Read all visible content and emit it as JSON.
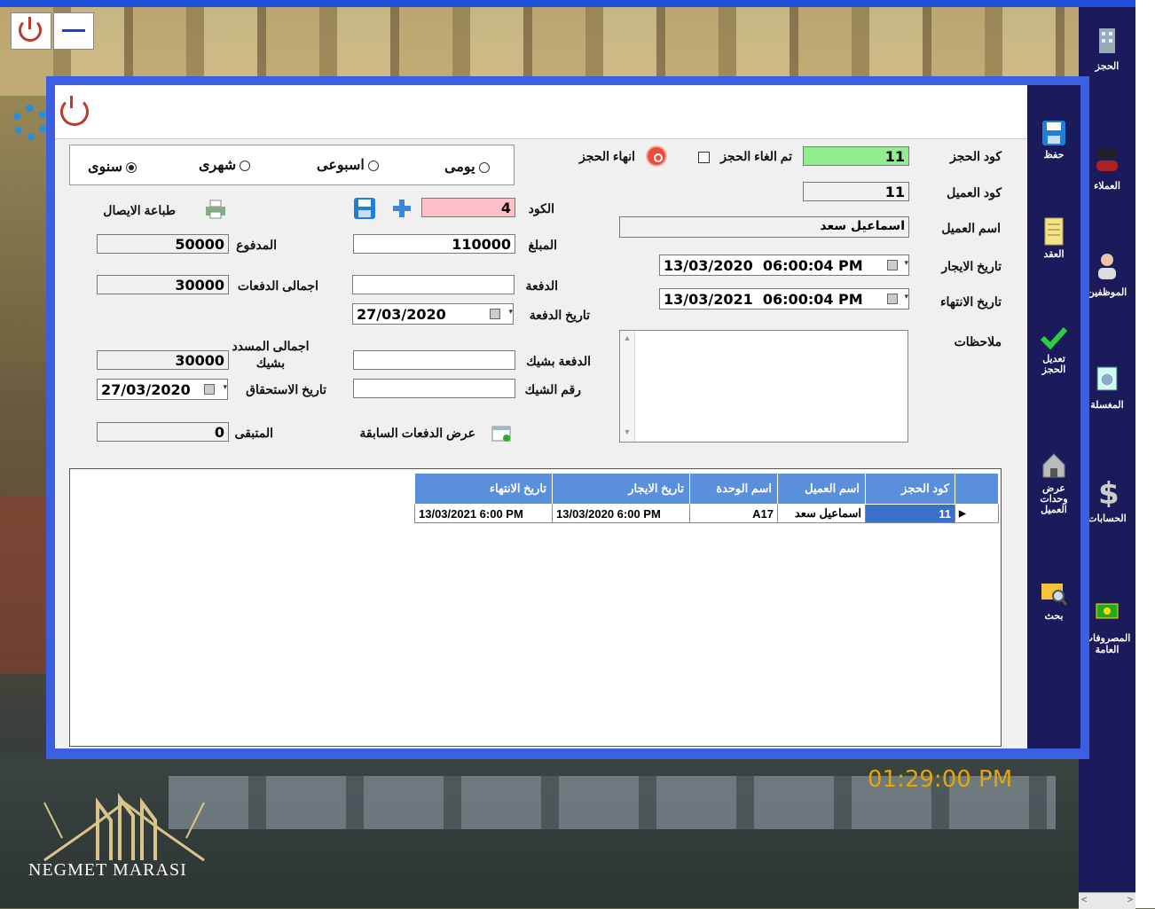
{
  "window": {
    "close_label": "power",
    "minimize_label": "minimize"
  },
  "sidebar": {
    "items": [
      {
        "label": "الحجز",
        "icon": "building-icon"
      },
      {
        "label": "العملاء",
        "icon": "users-icon"
      },
      {
        "label": "الموظفين",
        "icon": "employee-icon"
      },
      {
        "label": "المغسلة",
        "icon": "washing-machine-icon"
      },
      {
        "label": "الحسابات",
        "icon": "dollar-icon"
      },
      {
        "label": "المصروفات العامة",
        "icon": "money-icon"
      }
    ]
  },
  "nav": {
    "save": "حفظ",
    "contract": "العقد",
    "edit_booking": "تعديل الحجز",
    "client_units": "عرض وحدات العميل",
    "search": "بحث"
  },
  "form": {
    "booking_code_label": "كود الحجز",
    "booking_code": "11",
    "client_code_label": "كود العميل",
    "client_code": "11",
    "client_name_label": "اسم العميل",
    "client_name": "اسماعيل سعد",
    "rent_date_label": "تاريخ الايجار",
    "rent_date": "13/03/2020  06:00:04 PM",
    "end_date_label": "تاريخ الانتهاء",
    "end_date": "13/03/2021  06:00:04 PM",
    "notes_label": "ملاحظات",
    "cancel_label": "تم الغاء الحجز",
    "end_booking_label": "انهاء الحجز"
  },
  "period": {
    "options": [
      "يومى",
      "اسبوعى",
      "شهرى",
      "سنوى"
    ],
    "selected": "سنوى"
  },
  "payment": {
    "code_label": "الكود",
    "code": "4",
    "amount_label": "المبلغ",
    "amount": "110000",
    "payment_label": "الدفعة",
    "payment": "",
    "payment_date_label": "تاريخ الدفعة",
    "payment_date": "27/03/2020",
    "check_payment_label": "الدفعة بشيك",
    "check_payment": "",
    "check_no_label": "رقم الشيك",
    "check_no": "",
    "prev_payments_label": "عرض الدفعات السابقة",
    "print_receipt_label": "طباعة الايصال",
    "paid_label": "المدفوع",
    "paid": "50000",
    "total_payments_label": "اجمالى الدفعات",
    "total_payments": "30000",
    "total_check_label": "اجمالى المسدد بشيك",
    "total_check": "30000",
    "due_date_label": "تاريخ الاستحقاق",
    "due_date": "27/03/2020",
    "remaining_label": "المتبقى",
    "remaining": "0"
  },
  "grid": {
    "columns": [
      "كود الحجز",
      "اسم العميل",
      "اسم الوحدة",
      "تاريخ الايجار",
      "تاريخ الانتهاء"
    ],
    "rows": [
      [
        "11",
        "اسماعيل سعد",
        "A17",
        "13/03/2020 6:00 PM",
        "13/03/2021 6:00 PM"
      ]
    ]
  },
  "clock": "01:29:00 PM",
  "brand": "NEGMET MARASI",
  "colors": {
    "accent": "#3b5fe0",
    "sidebar": "#1b1b5c",
    "clock": "#e0a510",
    "booking_code_bg": "#90ee90",
    "code_bg": "#ffc0cb"
  }
}
